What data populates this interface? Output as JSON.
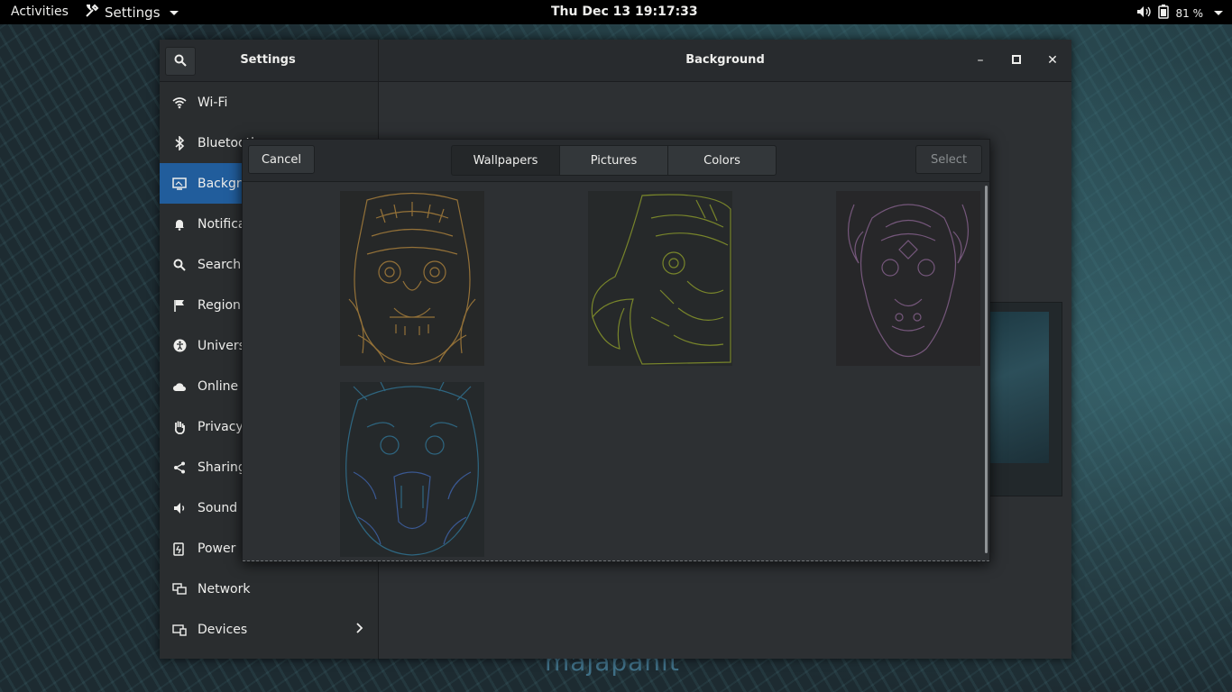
{
  "topbar": {
    "activities": "Activities",
    "app_menu": "Settings",
    "clock": "Thu Dec 13  19:17:33",
    "battery": "81 %"
  },
  "window": {
    "sidebar_title": "Settings",
    "title": "Background",
    "sidebar": [
      {
        "label": "Wi-Fi",
        "icon": "wifi-icon"
      },
      {
        "label": "Bluetooth",
        "icon": "bluetooth-icon"
      },
      {
        "label": "Background",
        "icon": "background-icon",
        "active": true
      },
      {
        "label": "Notifications",
        "icon": "bell-icon"
      },
      {
        "label": "Search",
        "icon": "search-icon"
      },
      {
        "label": "Region & Language",
        "icon": "flag-icon"
      },
      {
        "label": "Universal Access",
        "icon": "accessibility-icon"
      },
      {
        "label": "Online Accounts",
        "icon": "cloud-icon"
      },
      {
        "label": "Privacy",
        "icon": "hand-icon"
      },
      {
        "label": "Sharing",
        "icon": "share-icon"
      },
      {
        "label": "Sound",
        "icon": "speaker-icon"
      },
      {
        "label": "Power",
        "icon": "power-icon"
      },
      {
        "label": "Network",
        "icon": "network-icon"
      },
      {
        "label": "Devices",
        "icon": "devices-icon"
      }
    ]
  },
  "dialog": {
    "cancel": "Cancel",
    "tabs": [
      "Wallpapers",
      "Pictures",
      "Colors"
    ],
    "selected_tab": "Wallpapers",
    "select": "Select",
    "wallpapers": [
      {
        "name": "lion-mask",
        "color": "#a07a3a"
      },
      {
        "name": "eagle",
        "color": "#7d8a2a"
      },
      {
        "name": "bison",
        "color": "#7a5a80"
      },
      {
        "name": "tiger",
        "color": "#2f6a86"
      }
    ]
  },
  "desktop": {
    "watermark": "majapahit"
  }
}
